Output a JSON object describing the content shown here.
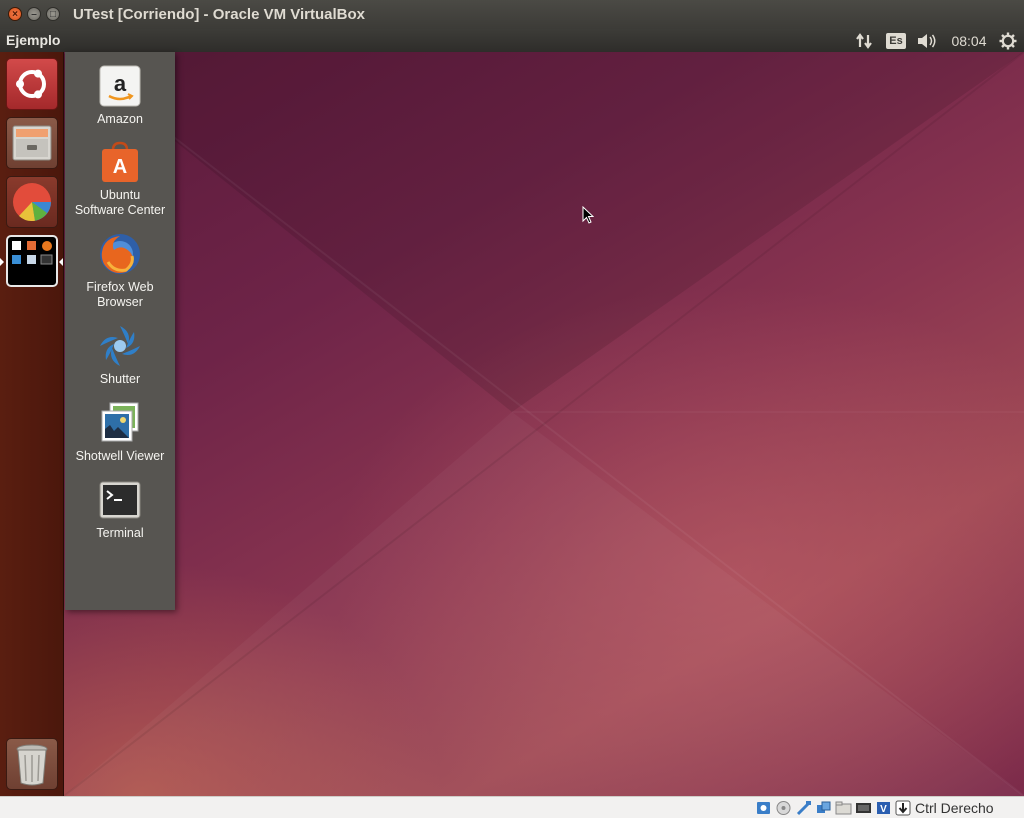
{
  "window": {
    "title": "UTest [Corriendo] - Oracle VM VirtualBox",
    "controls": [
      "×",
      "–",
      "□"
    ]
  },
  "panel": {
    "app_name": "Ejemplo",
    "keyboard_layout": "Es",
    "clock": "08:04"
  },
  "launcher": {
    "items": [
      "dash-home",
      "files",
      "impress",
      "workspace-switcher",
      "trash"
    ]
  },
  "apps": [
    {
      "label": "Amazon",
      "icon": "amazon-icon"
    },
    {
      "label": "Ubuntu\nSoftware Center",
      "icon": "software-center-icon"
    },
    {
      "label": "Firefox Web\nBrowser",
      "icon": "firefox-icon"
    },
    {
      "label": "Shutter",
      "icon": "shutter-icon"
    },
    {
      "label": "Shotwell Viewer",
      "icon": "shotwell-icon"
    },
    {
      "label": "Terminal",
      "icon": "terminal-icon"
    }
  ],
  "statusbar": {
    "host_key": "Ctrl Derecho"
  },
  "colors": {
    "launcher": "#4b170c",
    "drawer": "#575551",
    "accent": "#dd4814"
  }
}
